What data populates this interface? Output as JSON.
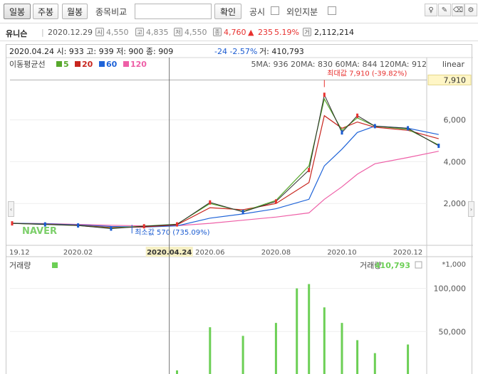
{
  "toolbar": {
    "btn_daily": "일봉",
    "btn_weekly": "주봉",
    "btn_monthly": "월봉",
    "compare_label": "종목비교",
    "search_placeholder": "",
    "confirm_label": "확인",
    "disclosure_label": "공시",
    "foreign_label": "외인지분"
  },
  "quote": {
    "name": "유니슨",
    "date": "2020.12.29",
    "open_badge": "시",
    "open": "4,550",
    "high_badge": "고",
    "high": "4,835",
    "low_badge": "저",
    "low": "4,550",
    "close_badge": "종",
    "close": "4,760",
    "change_arrow": "▲",
    "change": "235",
    "change_pct": "5.19%",
    "volume_badge": "거",
    "volume": "2,112,214"
  },
  "chart_info": {
    "cursor_date": "2020.04.24",
    "cursor_line": "2020.04.24 시: 933 고: 939 저: 900 종: 909",
    "cursor_change": "-24",
    "cursor_change_pct": "-2.57%",
    "cursor_volume": "거: 410,793",
    "ma_title": "이동평균선",
    "ma_values": "5MA: 936  20MA: 830  60MA: 844  120MA: 912",
    "scale_mode": "linear",
    "max_label": "최대값 7,910 (-39.82%)",
    "min_label": "최소값 570 (735.09%)",
    "watermark": "NAVER",
    "volume_title": "거래량",
    "volume_readout_label": "거래량:",
    "volume_readout": "410,793",
    "volume_multiplier": "*1,000",
    "max_price_tag": "7,910"
  },
  "colors": {
    "up": "#e8312f",
    "down": "#1a5bd1",
    "ma5": "#57a82c",
    "ma20": "#c8261f",
    "ma60": "#1e63d8",
    "ma120": "#ee5fa7",
    "volume": "#6ccf55"
  },
  "chart_data": {
    "type": "line",
    "price": {
      "x": [
        "2019-12",
        "2020-01",
        "2020-02",
        "2020-03",
        "2020-04",
        "2020-05",
        "2020-06",
        "2020-07",
        "2020-08",
        "2020-09",
        "2020-09-15",
        "2020-10",
        "2020-10-15",
        "2020-11",
        "2020-12",
        "2020-12-29"
      ],
      "close": [
        1050,
        1000,
        950,
        800,
        910,
        1000,
        2050,
        1600,
        2100,
        3600,
        7200,
        5400,
        6200,
        5700,
        5600,
        4760
      ],
      "ylim": [
        0,
        8300
      ],
      "yticks": [
        2000,
        4000,
        6000
      ],
      "ytick_labels": [
        "2,000",
        "4,000",
        "6,000"
      ],
      "max": 7910,
      "min": 570
    },
    "series": [
      {
        "name": "5",
        "values": [
          1050,
          1000,
          950,
          820,
          920,
          1010,
          2000,
          1620,
          2150,
          3800,
          7000,
          5500,
          6100,
          5700,
          5550,
          4800
        ]
      },
      {
        "name": "20",
        "values": [
          1050,
          1010,
          960,
          850,
          880,
          980,
          1800,
          1700,
          2000,
          3000,
          6200,
          5600,
          5900,
          5650,
          5500,
          5100
        ]
      },
      {
        "name": "60",
        "values": [
          1060,
          1030,
          980,
          900,
          870,
          930,
          1300,
          1500,
          1750,
          2200,
          3800,
          4600,
          5400,
          5700,
          5600,
          5300
        ]
      },
      {
        "name": "120",
        "values": [
          1050,
          1040,
          1000,
          960,
          930,
          940,
          1050,
          1200,
          1350,
          1550,
          2200,
          2800,
          3400,
          3900,
          4200,
          4500
        ]
      }
    ],
    "x_tick_labels": [
      "19.12",
      "2020.02",
      "2020.04.24",
      "2020.06",
      "2020.08",
      "2020.10",
      "2020.12"
    ],
    "volume": {
      "title": "거래량",
      "ylim": [
        0,
        112000
      ],
      "yticks": [
        50000,
        100000
      ],
      "ytick_labels": [
        "50,000",
        "100,000"
      ],
      "x": [
        "2020-05",
        "2020-06",
        "2020-07",
        "2020-08",
        "2020-08-20",
        "2020-09",
        "2020-09-15",
        "2020-10",
        "2020-10-15",
        "2020-11",
        "2020-12"
      ],
      "values": [
        5000,
        55000,
        45000,
        60000,
        100000,
        105000,
        78000,
        60000,
        40000,
        25000,
        35000
      ]
    }
  }
}
